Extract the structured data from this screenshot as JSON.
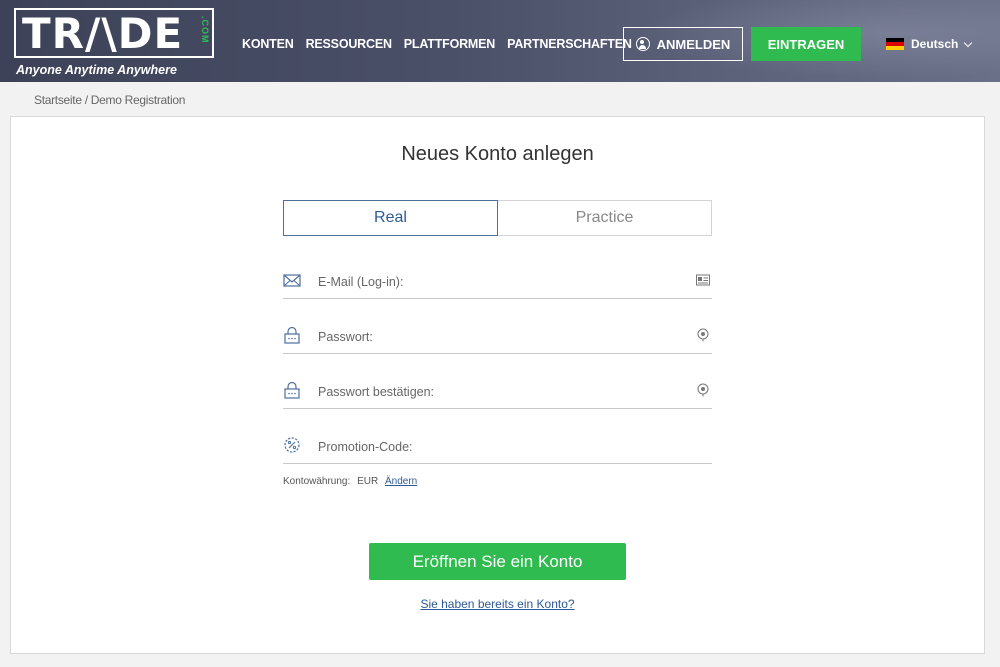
{
  "header": {
    "logo_text": "TR/\\DE",
    "logo_suffix": ".COM",
    "tagline": "Anyone Anytime Anywhere",
    "nav": [
      {
        "label": "KONTEN"
      },
      {
        "label": "RESSOURCEN"
      },
      {
        "label": "PLATTFORMEN"
      },
      {
        "label": "PARTNERSCHAFTEN"
      }
    ],
    "login_label": "ANMELDEN",
    "signup_label": "EINTRAGEN",
    "language": "Deutsch"
  },
  "breadcrumb": "Startseite / Demo Registration",
  "form": {
    "title": "Neues Konto anlegen",
    "tabs": [
      {
        "label": "Real"
      },
      {
        "label": "Practice"
      }
    ],
    "fields": {
      "email": "E-Mail (Log-in):",
      "password": "Passwort:",
      "password_confirm": "Passwort bestätigen:",
      "promo": "Promotion-Code:"
    },
    "currency_label": "Kontowährung:",
    "currency_value": "EUR",
    "currency_change": "Ändern",
    "submit_label": "Eröffnen Sie ein Konto",
    "have_account": "Sie haben bereits ein Konto?"
  },
  "colors": {
    "accent_green": "#2fbb4f",
    "link_blue": "#2e5a95",
    "header_bg": "#4a5068"
  }
}
